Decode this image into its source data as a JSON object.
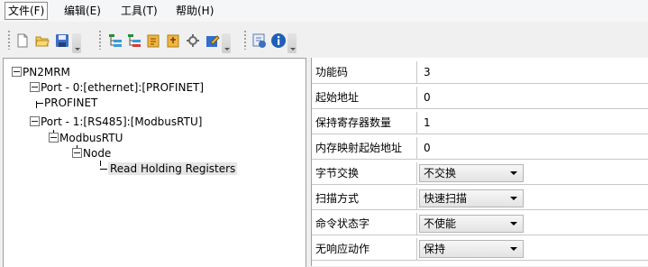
{
  "menu": {
    "items": [
      {
        "label": "文件(F)"
      },
      {
        "label": "编辑(E)"
      },
      {
        "label": "工具(T)"
      },
      {
        "label": "帮助(H)"
      }
    ]
  },
  "toolbar": {
    "buttons": [
      {
        "icon": "new-file-icon"
      },
      {
        "icon": "open-folder-icon"
      },
      {
        "icon": "save-icon"
      },
      {
        "icon": "add-node-icon"
      },
      {
        "icon": "delete-node-icon"
      },
      {
        "icon": "import-icon"
      },
      {
        "icon": "export-icon"
      },
      {
        "icon": "settings-icon"
      },
      {
        "icon": "edit-icon"
      },
      {
        "icon": "run-icon"
      },
      {
        "icon": "info-icon"
      }
    ]
  },
  "tree": {
    "root": "PN2MRM",
    "port0": "Port - 0:[ethernet]:[PROFINET]",
    "profinet": "PROFINET",
    "port1": "Port - 1:[RS485]:[ModbusRTU]",
    "modbus": "ModbusRTU",
    "node": "Node",
    "command": "Read Holding Registers"
  },
  "properties": {
    "rows": [
      {
        "key": "功能码",
        "value": "3"
      },
      {
        "key": "起始地址",
        "value": "0"
      },
      {
        "key": "保持寄存器数量",
        "value": "1"
      },
      {
        "key": "内存映射起始地址",
        "value": "0"
      },
      {
        "key": "字节交换",
        "value": "不交换"
      },
      {
        "key": "扫描方式",
        "value": "快速扫描"
      },
      {
        "key": "命令状态字",
        "value": "不使能"
      },
      {
        "key": "无响应动作",
        "value": "保持"
      }
    ]
  }
}
